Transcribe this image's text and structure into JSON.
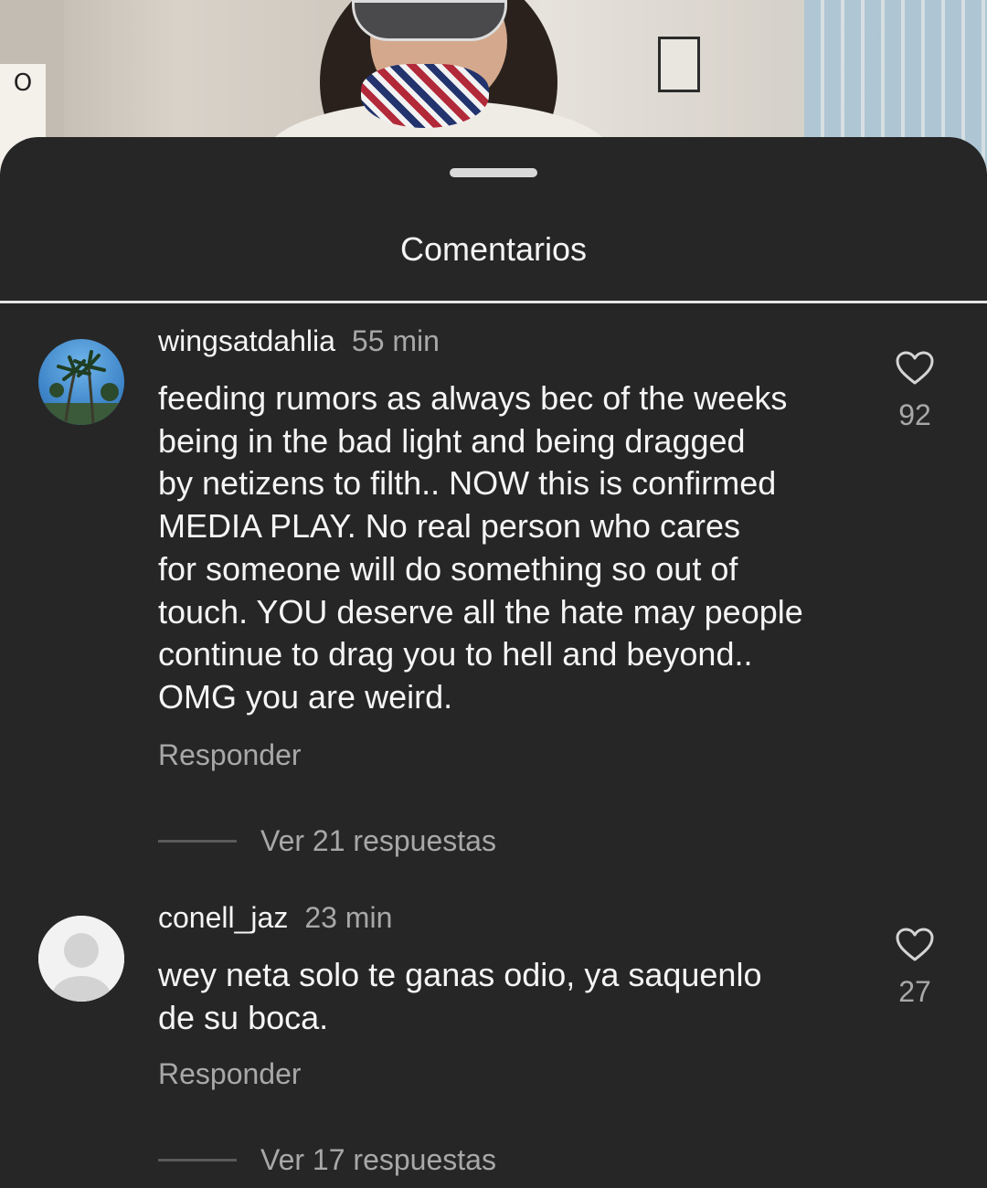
{
  "sheet": {
    "title": "Comentarios"
  },
  "comments": [
    {
      "username": "wingsatdahlia",
      "time": "55 min",
      "text": "feeding rumors as always bec of the weeks\nbeing in the bad light and being dragged\nby netizens to filth.. NOW this is confirmed\nMEDIA PLAY. No real person who cares\nfor someone will do something so out of\ntouch. YOU deserve all the hate may people\ncontinue to drag you to hell and beyond..\nOMG you are weird.",
      "reply_label": "Responder",
      "likes": "92",
      "view_replies": "Ver 21 respuestas",
      "avatar_icon": "palm-tree-avatar"
    },
    {
      "username": "conell_jaz",
      "time": "23 min",
      "text": "wey neta solo te ganas odio, ya saquenlo\nde su boca.",
      "reply_label": "Responder",
      "likes": "27",
      "view_replies": "Ver 17 respuestas",
      "avatar_icon": "default-user-avatar"
    }
  ],
  "photo_sign_text": "O",
  "colors": {
    "sheet_bg": "#262626",
    "primary_text": "#f5f5f5",
    "secondary_text": "#a8a8a8"
  }
}
